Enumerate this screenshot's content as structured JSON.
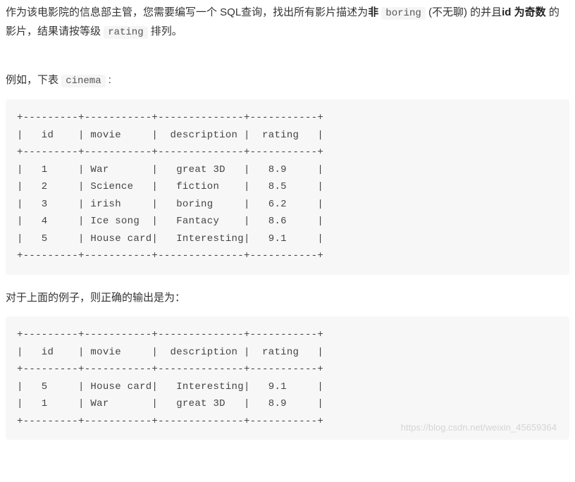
{
  "intro": {
    "segment1": "作为该电影院的信息部主管，您需要编写一个 SQL查询，找出所有影片描述为",
    "bold1": "非",
    "code1": "boring",
    "paren1": "(不无聊) 的并且",
    "bold2": "id 为奇数",
    "segment2": "的影片，结果请按等级",
    "code2": "rating",
    "segment3": "排列。"
  },
  "example_label": {
    "prefix": "例如，下表",
    "code": "cinema",
    "suffix": ":"
  },
  "table1_text": "+---------+-----------+--------------+-----------+\n|   id    | movie     |  description |  rating   |\n+---------+-----------+--------------+-----------+\n|   1     | War       |   great 3D   |   8.9     |\n|   2     | Science   |   fiction    |   8.5     |\n|   3     | irish     |   boring     |   6.2     |\n|   4     | Ice song  |   Fantacy    |   8.6     |\n|   5     | House card|   Interesting|   9.1     |\n+---------+-----------+--------------+-----------+",
  "result_label": "对于上面的例子，则正确的输出是为：",
  "table2_text": "+---------+-----------+--------------+-----------+\n|   id    | movie     |  description |  rating   |\n+---------+-----------+--------------+-----------+\n|   5     | House card|   Interesting|   9.1     |\n|   1     | War       |   great 3D   |   8.9     |\n+---------+-----------+--------------+-----------+",
  "watermark": "https://blog.csdn.net/weixin_45659364",
  "chart_data": [
    {
      "type": "table",
      "title": "cinema",
      "columns": [
        "id",
        "movie",
        "description",
        "rating"
      ],
      "rows": [
        [
          1,
          "War",
          "great 3D",
          8.9
        ],
        [
          2,
          "Science",
          "fiction",
          8.5
        ],
        [
          3,
          "irish",
          "boring",
          6.2
        ],
        [
          4,
          "Ice song",
          "Fantacy",
          8.6
        ],
        [
          5,
          "House card",
          "Interesting",
          9.1
        ]
      ]
    },
    {
      "type": "table",
      "title": "correct output",
      "columns": [
        "id",
        "movie",
        "description",
        "rating"
      ],
      "rows": [
        [
          5,
          "House card",
          "Interesting",
          9.1
        ],
        [
          1,
          "War",
          "great 3D",
          8.9
        ]
      ]
    }
  ]
}
